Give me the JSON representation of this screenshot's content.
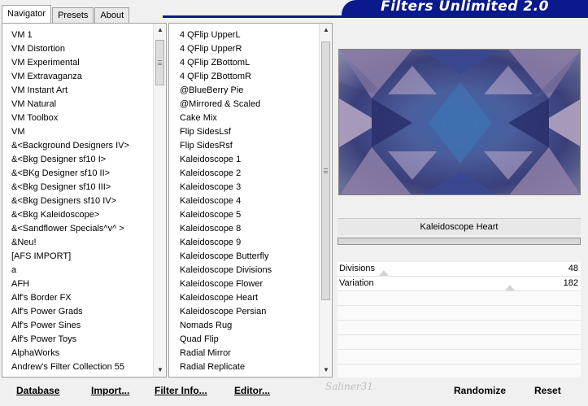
{
  "app": {
    "title": "Filters Unlimited 2.0"
  },
  "tabs": [
    {
      "label": "Navigator",
      "active": true
    },
    {
      "label": "Presets",
      "active": false
    },
    {
      "label": "About",
      "active": false
    }
  ],
  "categories": {
    "items": [
      "VM 1",
      "VM Distortion",
      "VM Experimental",
      "VM Extravaganza",
      "VM Instant Art",
      "VM Natural",
      "VM Toolbox",
      "VM",
      "&<Background Designers IV>",
      "&<Bkg Designer sf10 I>",
      "&<BKg Designer sf10 II>",
      "&<Bkg Designer sf10 III>",
      "&<Bkg Designers sf10 IV>",
      "&<Bkg Kaleidoscope>",
      "&<Sandflower Specials^v^ >",
      "&Neu!",
      "[AFS IMPORT]",
      "a",
      "AFH",
      "Alf's Border FX",
      "Alf's Power Grads",
      "Alf's Power Sines",
      "Alf's Power Toys",
      "AlphaWorks",
      "Andrew's Filter Collection 55"
    ],
    "scroll_position": 0.08
  },
  "filters": {
    "items": [
      "4 QFlip UpperL",
      "4 QFlip UpperR",
      "4 QFlip ZBottomL",
      "4 QFlip ZBottomR",
      "@BlueBerry Pie",
      "@Mirrored & Scaled",
      "Cake Mix",
      "Flip SidesLsf",
      "Flip SidesRsf",
      "Kaleidoscope 1",
      "Kaleidoscope 2",
      "Kaleidoscope 3",
      "Kaleidoscope 4",
      "Kaleidoscope 5",
      "Kaleidoscope 8",
      "Kaleidoscope 9",
      "Kaleidoscope Butterfly",
      "Kaleidoscope Divisions",
      "Kaleidoscope Flower",
      "Kaleidoscope Heart",
      "Kaleidoscope Persian",
      "Nomads Rug",
      "Quad Flip",
      "Radial Mirror",
      "Radial Replicate"
    ],
    "selected": "Kaleidoscope Heart",
    "scroll_position": 0.02
  },
  "preview": {
    "filter_name": "Kaleidoscope Heart",
    "progress": 0
  },
  "parameters": [
    {
      "label": "Divisions",
      "value": "48",
      "level": 0.19
    },
    {
      "label": "Variation",
      "value": "182",
      "level": 0.71
    }
  ],
  "buttons": {
    "database": "Database",
    "import": "Import...",
    "filter_info": "Filter Info...",
    "editor": "Editor...",
    "randomize": "Randomize",
    "reset": "Reset"
  },
  "watermark": "Saliner31"
}
